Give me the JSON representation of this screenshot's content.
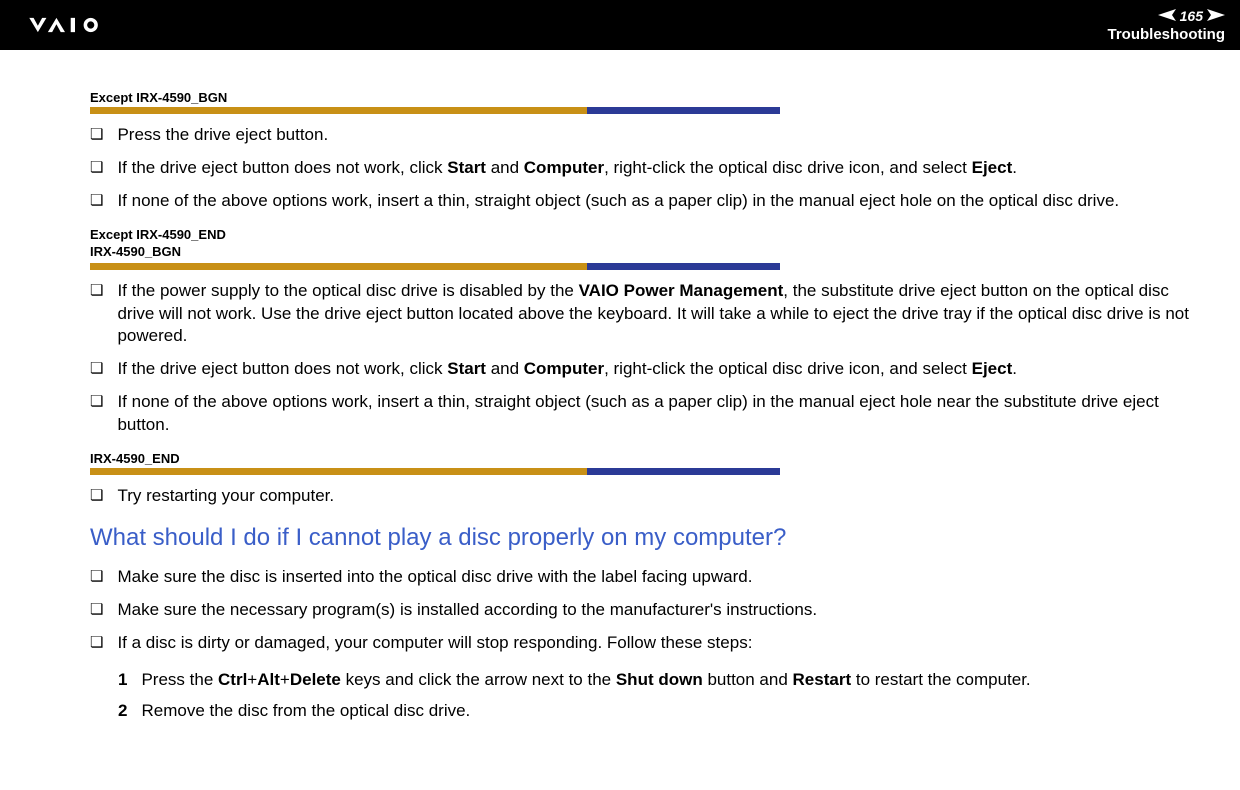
{
  "header": {
    "page_number": "165",
    "section": "Troubleshooting"
  },
  "tags": {
    "tag1": "Except IRX-4590_BGN",
    "tag2_line1": "Except IRX-4590_END",
    "tag2_line2": "IRX-4590_BGN",
    "tag3": "IRX-4590_END"
  },
  "block1": {
    "item1": "Press the drive eject button.",
    "item2_pre": "If the drive eject button does not work, click ",
    "item2_b1": "Start",
    "item2_mid1": " and ",
    "item2_b2": "Computer",
    "item2_mid2": ", right-click the optical disc drive icon, and select ",
    "item2_b3": "Eject",
    "item2_post": ".",
    "item3": "If none of the above options work, insert a thin, straight object (such as a paper clip) in the manual eject hole on the optical disc drive."
  },
  "block2": {
    "item1_pre": "If the power supply to the optical disc drive is disabled by the ",
    "item1_b1": "VAIO Power Management",
    "item1_post": ", the substitute drive eject button on the optical disc drive will not work. Use the drive eject button located above the keyboard. It will take a while to eject the drive tray if the optical disc drive is not powered.",
    "item2_pre": "If the drive eject button does not work, click ",
    "item2_b1": "Start",
    "item2_mid1": " and ",
    "item2_b2": "Computer",
    "item2_mid2": ", right-click the optical disc drive icon, and select ",
    "item2_b3": "Eject",
    "item2_post": ".",
    "item3": "If none of the above options work, insert a thin, straight object (such as a paper clip) in the manual eject hole near the substitute drive eject button."
  },
  "block3": {
    "item1": "Try restarting your computer."
  },
  "heading": "What should I do if I cannot play a disc properly on my computer?",
  "block4": {
    "item1": "Make sure the disc is inserted into the optical disc drive with the label facing upward.",
    "item2": "Make sure the necessary program(s) is installed according to the manufacturer's instructions.",
    "item3": "If a disc is dirty or damaged, your computer will stop responding. Follow these steps:",
    "step1_num": "1",
    "step1_pre": "Press the ",
    "step1_b1": "Ctrl",
    "step1_plus1": "+",
    "step1_b2": "Alt",
    "step1_plus2": "+",
    "step1_b3": "Delete",
    "step1_mid": " keys and click the arrow next to the ",
    "step1_b4": "Shut down",
    "step1_mid2": " button and ",
    "step1_b5": "Restart",
    "step1_post": " to restart the computer.",
    "step2_num": "2",
    "step2": "Remove the disc from the optical disc drive."
  }
}
